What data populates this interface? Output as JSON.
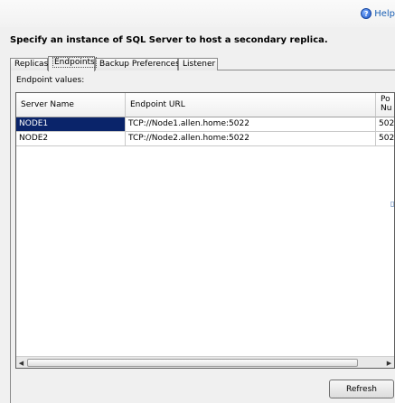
{
  "header": {
    "help_label": "Help"
  },
  "page_title": "Specify an instance of SQL Server to host a secondary replica.",
  "tabs": [
    {
      "label": "Replicas",
      "active": false
    },
    {
      "label": "Endpoints",
      "active": true
    },
    {
      "label": "Backup Preferences",
      "active": false
    },
    {
      "label": "Listener",
      "active": false
    }
  ],
  "endpoints": {
    "label": "Endpoint values:",
    "columns": [
      "Server Name",
      "Endpoint URL",
      "Po\nNu"
    ],
    "rows": [
      {
        "server": "NODE1",
        "url": "TCP://Node1.allen.home:5022",
        "port": "502",
        "selected": true
      },
      {
        "server": "NODE2",
        "url": "TCP://Node2.allen.home:5022",
        "port": "502",
        "selected": false
      }
    ]
  },
  "buttons": {
    "refresh": "Refresh"
  },
  "colors": {
    "selection": "#0a246a",
    "help_link": "#1a5fb4"
  }
}
